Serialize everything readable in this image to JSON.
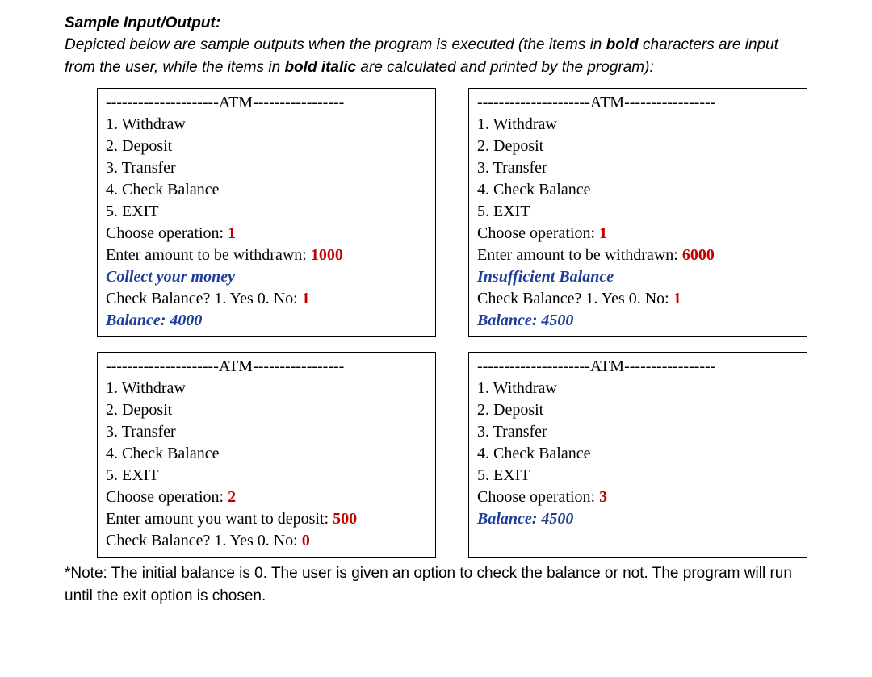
{
  "heading": "Sample Input/Output:",
  "intro": {
    "t1": "Depicted below are sample outputs when the program is executed (the items in ",
    "b1": "bold",
    "t2": " characters are input from the user, while the items in ",
    "b2": "bold italic",
    "t3": " are calculated and printed by the program):"
  },
  "menu": {
    "header": "---------------------ATM-----------------",
    "m1": "1. Withdraw",
    "m2": "2. Deposit",
    "m3": "3. Transfer",
    "m4": "4. Check Balance",
    "m5": "5. EXIT",
    "choose": "Choose operation: ",
    "withdrawPrompt": "Enter amount to be withdrawn: ",
    "depositPrompt": "Enter amount you want to deposit: ",
    "checkBal": "Check Balance? 1. Yes   0. No: "
  },
  "box1": {
    "choice": "1",
    "amount": "1000",
    "msg": "Collect your money",
    "cb": "1",
    "bal": "Balance: 4000"
  },
  "box2": {
    "choice": "1",
    "amount": "6000",
    "msg": "Insufficient Balance",
    "cb": "1",
    "bal": "Balance: 4500"
  },
  "box3": {
    "choice": "2",
    "amount": "500",
    "cb": "0"
  },
  "box4": {
    "choice": "3",
    "bal": "Balance: 4500"
  },
  "note": "*Note: The initial balance is 0. The user is given an option to check the balance or not. The program will run until the exit option is chosen."
}
